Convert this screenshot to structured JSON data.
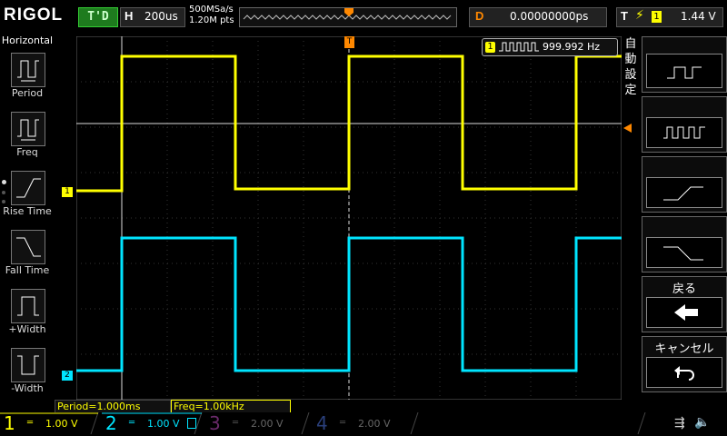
{
  "topbar": {
    "logo": "RIGOL",
    "trigger_status": "T'D",
    "horizontal_key": "H",
    "timebase": "200us",
    "sample_rate": "500MSa/s",
    "memory_depth": "1.20M pts",
    "delay_key": "D",
    "delay_value": "0.00000000ps",
    "trigger_key": "T",
    "trigger_channel": "1",
    "trigger_level": "1.44 V"
  },
  "left_menu": {
    "title": "Horizontal",
    "items": [
      {
        "label": "Period",
        "icon": "period-icon"
      },
      {
        "label": "Freq",
        "icon": "freq-icon"
      },
      {
        "label": "Rise Time",
        "icon": "rise-time-icon"
      },
      {
        "label": "Fall Time",
        "icon": "fall-time-icon"
      },
      {
        "label": "+Width",
        "icon": "plus-width-icon"
      },
      {
        "label": "-Width",
        "icon": "minus-width-icon"
      }
    ]
  },
  "right_menu": {
    "auto_label": "自動設定",
    "items": [
      {
        "label": "",
        "icon": "single-pulse-icon"
      },
      {
        "label": "",
        "icon": "pulse-train-icon"
      },
      {
        "label": "",
        "icon": "rising-edge-icon"
      },
      {
        "label": "",
        "icon": "falling-edge-icon"
      },
      {
        "label": "戻る",
        "icon": "back-arrow-icon"
      },
      {
        "label": "キャンセル",
        "icon": "undo-icon"
      }
    ]
  },
  "screen": {
    "freq_channel": "1",
    "freq_value": "999.992 Hz",
    "ch1_marker": "1",
    "ch2_marker": "2",
    "trigger_marker": "T"
  },
  "measurements": {
    "period": "Period=1.000ms",
    "freq": "Freq=1.00kHz"
  },
  "bottom": {
    "channels": [
      {
        "num": "1",
        "scale": "1.00 V",
        "color": "#ffff00",
        "active": true
      },
      {
        "num": "2",
        "scale": "1.00 V",
        "color": "#00e5ff",
        "active": true
      },
      {
        "num": "3",
        "scale": "2.00 V",
        "color": "#b040b0",
        "active": false
      },
      {
        "num": "4",
        "scale": "2.00 V",
        "color": "#3060d0",
        "active": false
      }
    ]
  },
  "colors": {
    "ch1": "#ffff00",
    "ch2": "#00e5ff",
    "trigger": "#ff8800"
  }
}
